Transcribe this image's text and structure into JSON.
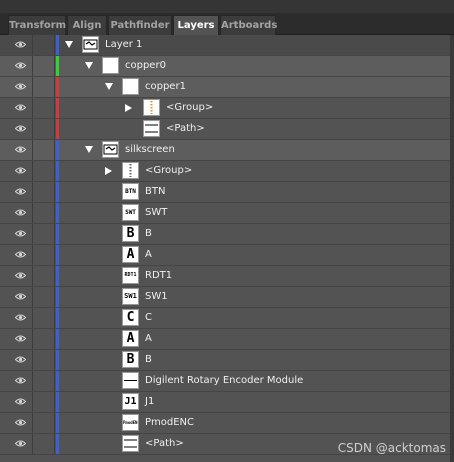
{
  "tabs": [
    {
      "label": "Transform",
      "active": false
    },
    {
      "label": "Align",
      "active": false
    },
    {
      "label": "Pathfinder",
      "active": false
    },
    {
      "label": "Layers",
      "active": true
    },
    {
      "label": "Artboards",
      "active": false
    }
  ],
  "colors": {
    "blue": "#3b5fd8",
    "green": "#2fd62f",
    "red": "#d23a3a"
  },
  "rows": [
    {
      "label": "Layer 1",
      "toggle": "down",
      "thumb": "layer",
      "color": "blue"
    },
    {
      "label": "copper0",
      "toggle": "down",
      "thumb": "blank",
      "color": "green"
    },
    {
      "label": "copper1",
      "toggle": "down",
      "thumb": "blank",
      "color": "red"
    },
    {
      "label": "<Group>",
      "toggle": "right",
      "thumb": "group",
      "color": "red"
    },
    {
      "label": "<Path>",
      "toggle": "none",
      "thumb": "path",
      "color": "red"
    },
    {
      "label": "silkscreen",
      "toggle": "down",
      "thumb": "layer",
      "color": "blue"
    },
    {
      "label": "<Group>",
      "toggle": "right",
      "thumb": "group",
      "color": "blue"
    },
    {
      "label": "BTN",
      "toggle": "none",
      "thumb": "BTN",
      "color": "blue"
    },
    {
      "label": "SWT",
      "toggle": "none",
      "thumb": "SWT",
      "color": "blue"
    },
    {
      "label": "B",
      "toggle": "none",
      "thumb": "B",
      "color": "blue"
    },
    {
      "label": "A",
      "toggle": "none",
      "thumb": "A",
      "color": "blue"
    },
    {
      "label": "RDT1",
      "toggle": "none",
      "thumb": "RDT1",
      "color": "blue"
    },
    {
      "label": "SW1",
      "toggle": "none",
      "thumb": "SW1",
      "color": "blue"
    },
    {
      "label": "C",
      "toggle": "none",
      "thumb": "C",
      "color": "blue"
    },
    {
      "label": "A",
      "toggle": "none",
      "thumb": "A",
      "color": "blue"
    },
    {
      "label": "B",
      "toggle": "none",
      "thumb": "B",
      "color": "blue"
    },
    {
      "label": "Digilent Rotary Encoder Module",
      "toggle": "none",
      "thumb": "line",
      "color": "blue"
    },
    {
      "label": "J1",
      "toggle": "none",
      "thumb": "J1",
      "color": "blue"
    },
    {
      "label": "PmodENC",
      "toggle": "none",
      "thumb": "PmodENC",
      "color": "blue"
    },
    {
      "label": "<Path>",
      "toggle": "none",
      "thumb": "path",
      "color": "blue"
    }
  ],
  "watermark": "CSDN @acktomas"
}
